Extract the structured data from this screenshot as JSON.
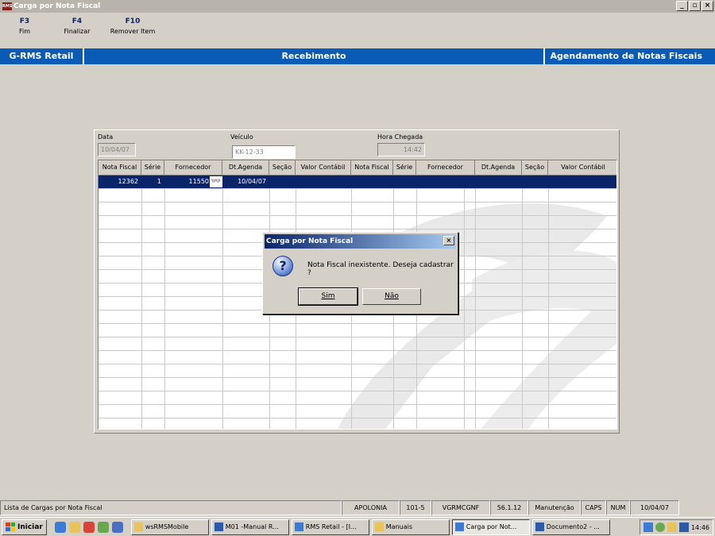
{
  "window": {
    "title": "Carga por Nota Fiscal",
    "icon_text": "RMS"
  },
  "fkeys": [
    {
      "key": "F3",
      "label": "Fim"
    },
    {
      "key": "F4",
      "label": "Finalizar"
    },
    {
      "key": "F10",
      "label": "Remover Item"
    }
  ],
  "header": {
    "left": "G-RMS Retail",
    "center": "Recebimento",
    "right": "Agendamento de Notas Fiscais"
  },
  "form": {
    "data_label": "Data",
    "data_value": "10/04/07",
    "veiculo_label": "Veículo",
    "veiculo_value": "KK-12-33",
    "hora_label": "Hora Chegada",
    "hora_value": "14:42"
  },
  "grid": {
    "columns": [
      "Nota Fiscal",
      "Série",
      "Fornecedor",
      "Dt.Agenda",
      "Seção",
      "Valor Contábil",
      "Nota Fiscal",
      "Série",
      "Fornecedor",
      "Dt.Agenda",
      "Seção",
      "Valor Contábil"
    ],
    "row": {
      "nota_fiscal": "12362",
      "serie": "1",
      "fornecedor": "11550",
      "dt_agenda": "10/04/07"
    }
  },
  "dialog": {
    "title": "Carga por Nota Fiscal",
    "message": "Nota Fiscal inexistente. Deseja cadastrar ?",
    "yes": "Sim",
    "no": "Não"
  },
  "status": {
    "left": "Lista de Cargas por Nota Fiscal",
    "cells": [
      "APOLONIA",
      "101-5",
      "VGRMCGNF",
      "56.1.12",
      "Manutenção",
      "CAPS",
      "NUM",
      "10/04/07"
    ]
  },
  "taskbar": {
    "start": "Iniciar",
    "buttons": [
      "wsRMSMobile",
      "M01 -Manual R...",
      "RMS Retail - [I...",
      "Manuais",
      "Carga por Not...",
      "Documento2 - ..."
    ],
    "clock": "14:46"
  },
  "colors": {
    "brand_bar": "#0a5bb6",
    "selection": "#0a246a"
  }
}
